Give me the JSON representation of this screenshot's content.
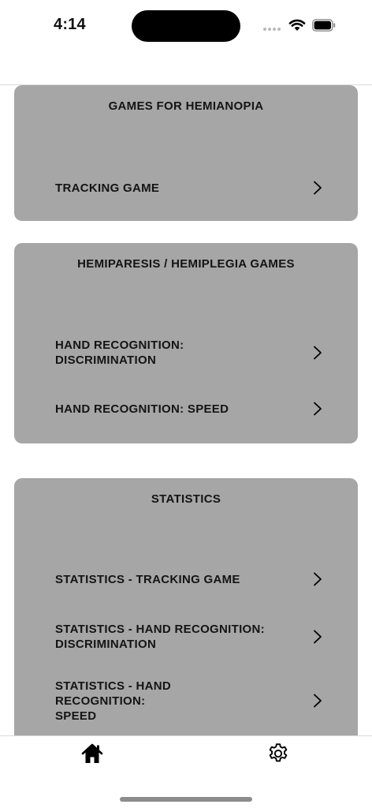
{
  "status_bar": {
    "time": "4:14"
  },
  "sections": [
    {
      "title": "GAMES FOR HEMIANOPIA",
      "items": [
        {
          "label": "TRACKING GAME"
        }
      ]
    },
    {
      "title": "HEMIPARESIS / HEMIPLEGIA GAMES",
      "items": [
        {
          "label": "HAND RECOGNITION: DISCRIMINATION"
        },
        {
          "label": "HAND RECOGNITION: SPEED"
        }
      ]
    },
    {
      "title": "STATISTICS",
      "items": [
        {
          "label": "STATISTICS - TRACKING GAME"
        },
        {
          "label": "STATISTICS - HAND RECOGNITION: DISCRIMINATION"
        },
        {
          "label": "STATISTICS - HAND RECOGNITION: SPEED"
        }
      ]
    }
  ],
  "tab_bar": {
    "tabs": [
      {
        "icon": "home-icon"
      },
      {
        "icon": "gear-icon"
      }
    ]
  },
  "colors": {
    "card_background": "#a6a6a6",
    "text": "#141414"
  }
}
